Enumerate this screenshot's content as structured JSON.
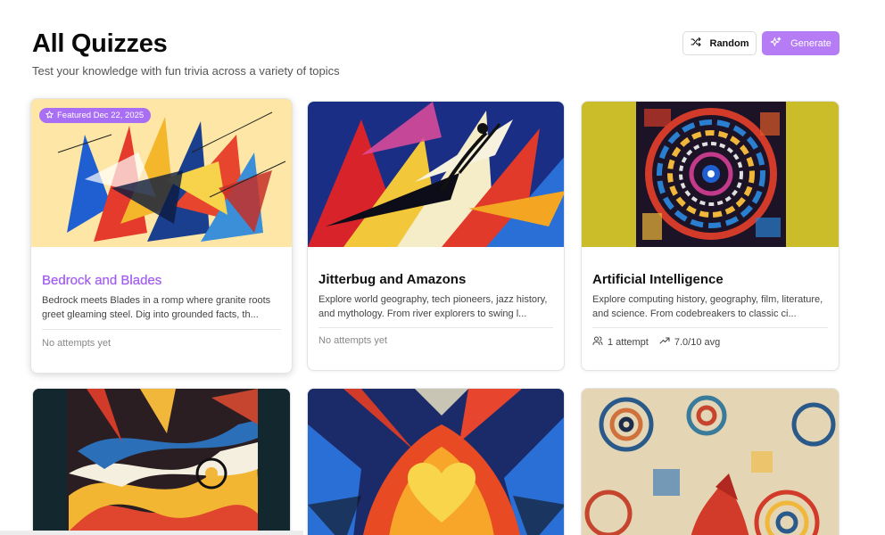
{
  "header": {
    "title": "All Quizzes",
    "subtitle": "Test your knowledge with fun trivia across a variety of topics"
  },
  "actions": {
    "random_label": "Random",
    "random_icon": "shuffle-icon",
    "generate_label": "Generate",
    "generate_icon": "sparkles-icon",
    "accent_color": "#b57cf5"
  },
  "quizzes": [
    {
      "title": "Bedrock and Blades",
      "description": "Bedrock meets Blades in a romp where granite roots greet gleaming steel. Dig into grounded facts, th...",
      "badge": "Featured Dec 22, 2025",
      "badge_icon": "star-icon",
      "meta": "No attempts yet"
    },
    {
      "title": "Jitterbug and Amazons",
      "description": "Explore world geography, tech pioneers, jazz history, and mythology. From river explorers to swing l...",
      "meta": "No attempts yet"
    },
    {
      "title": "Artificial Intelligence",
      "description": "Explore computing history, geography, film, literature, and science. From codebreakers to classic ci...",
      "attempts": "1 attempt",
      "attempts_icon": "users-icon",
      "average": "7.0/10 avg",
      "average_icon": "trending-up-icon"
    },
    {
      "art": "abstract storm painting"
    },
    {
      "art": "abstract flaming heart painting"
    },
    {
      "art": "abstract spiral gears painting"
    }
  ]
}
